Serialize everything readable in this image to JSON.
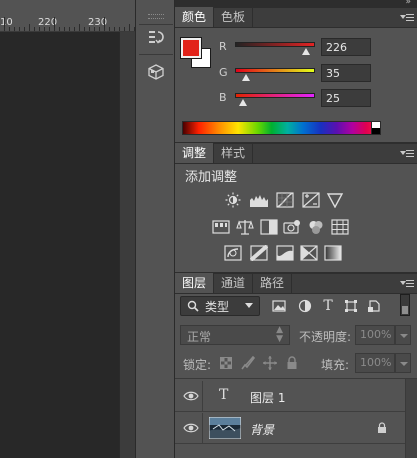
{
  "ruler": {
    "numbers": [
      "10",
      "220",
      "230"
    ]
  },
  "color_panel": {
    "tabs": [
      {
        "label": "颜色",
        "active": true
      },
      {
        "label": "色板",
        "active": false
      }
    ],
    "foreground_color": "#e2231a",
    "background_color": "#ffffff",
    "channels": [
      {
        "label": "R",
        "value": "226",
        "fraction": 0.886,
        "gradient": [
          "#232323",
          "#e22323"
        ]
      },
      {
        "label": "G",
        "value": "35",
        "fraction": 0.137,
        "gradient": [
          "#e20019",
          "#e2ff19"
        ]
      },
      {
        "label": "B",
        "value": "25",
        "fraction": 0.098,
        "gradient": [
          "#e22300",
          "#e223ff"
        ]
      }
    ]
  },
  "adjustments_panel": {
    "tabs": [
      {
        "label": "调整",
        "active": true
      },
      {
        "label": "样式",
        "active": false
      }
    ],
    "title": "添加调整",
    "icons": [
      [
        "brightness-contrast-icon",
        "levels-icon",
        "curves-icon",
        "exposure-icon",
        "vibrance-icon"
      ],
      [
        "hue-saturation-icon",
        "color-balance-icon",
        "black-white-icon",
        "photo-filter-icon",
        "channel-mixer-icon",
        "color-lookup-icon"
      ],
      [
        "invert-icon",
        "posterize-icon",
        "threshold-icon",
        "selective-color-icon",
        "gradient-map-icon"
      ]
    ]
  },
  "layers_panel": {
    "tabs": [
      {
        "label": "图层",
        "active": true
      },
      {
        "label": "通道",
        "active": false
      },
      {
        "label": "路径",
        "active": false
      }
    ],
    "filter_kind": "类型",
    "filter_icons": [
      "pixel-filter-icon",
      "adjustment-filter-icon",
      "type-filter-icon",
      "shape-filter-icon",
      "smart-object-filter-icon"
    ],
    "blend_mode": "正常",
    "opacity_label": "不透明度:",
    "opacity_value": "100%",
    "lock_label": "锁定:",
    "fill_label": "填充:",
    "fill_value": "100%",
    "lock_icons": [
      "lock-transparent-icon",
      "lock-image-icon",
      "lock-position-icon",
      "lock-all-icon"
    ],
    "layers": [
      {
        "name": "图层 1",
        "type": "text",
        "visible": true,
        "locked": false
      },
      {
        "name": "背景",
        "type": "image",
        "visible": true,
        "locked": true
      }
    ]
  }
}
